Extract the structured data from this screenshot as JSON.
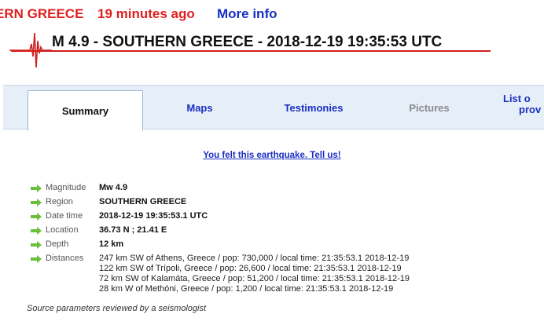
{
  "ticker": {
    "region": "ERN GREECE",
    "time_ago": "19 minutes ago",
    "more_info": "More info"
  },
  "title": "M 4.9 - SOUTHERN GREECE - 2018-12-19 19:35:53 UTC",
  "tabs": [
    {
      "label": "Summary"
    },
    {
      "label": "Maps"
    },
    {
      "label": "Testimonies"
    },
    {
      "label": "Pictures"
    },
    {
      "label_line1": "List o",
      "label_line2": "prov"
    }
  ],
  "felt_link": "You felt this earthquake. Tell us!",
  "info": {
    "magnitude": {
      "label": "Magnitude",
      "value": "Mw 4.9"
    },
    "region": {
      "label": "Region",
      "value": "SOUTHERN GREECE"
    },
    "datetime": {
      "label": "Date time",
      "value": "2018-12-19 19:35:53.1 UTC"
    },
    "location": {
      "label": "Location",
      "value": "36.73 N ; 21.41 E"
    },
    "depth": {
      "label": "Depth",
      "value": "12 km"
    },
    "distances": {
      "label": "Distances",
      "items": [
        "247 km SW of Athens, Greece / pop: 730,000 / local time: 21:35:53.1 2018-12-19",
        "122 km SW of Trípoli, Greece / pop: 26,600 / local time: 21:35:53.1 2018-12-19",
        "72 km SW of Kalamáta, Greece / pop: 51,200 / local time: 21:35:53.1 2018-12-19",
        "28 km W of Methóni, Greece / pop: 1,200 / local time: 21:35:53.1 2018-12-19"
      ]
    }
  },
  "source_note": "Source parameters reviewed by a seismologist",
  "colors": {
    "alert_red": "#e02020",
    "link_blue": "#1a2fc4",
    "tab_bg": "#e6eef8",
    "arrow_green": "#6bbf3a"
  }
}
